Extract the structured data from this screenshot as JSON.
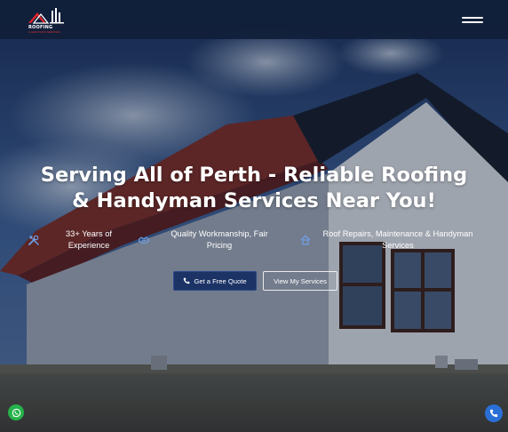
{
  "header": {
    "logo_brand": "ROOFING",
    "logo_tag": "& HANDYMAN SERVICES",
    "menu_icon": "hamburger-icon"
  },
  "hero": {
    "headline_line1": "Serving All of Perth - Reliable Roofing",
    "headline_line2": "& Handyman Services Near You!",
    "features": [
      {
        "icon": "tools-icon",
        "line1": "33+ Years of",
        "line2": "Experience"
      },
      {
        "icon": "handshake-icon",
        "line1": "Quality Workmanship, Fair",
        "line2": "Pricing"
      },
      {
        "icon": "house-icon",
        "line1": "Roof Repairs, Maintenance & Handyman",
        "line2": "Services"
      }
    ],
    "buttons": {
      "quote_label": "Get a Free Quote",
      "quote_icon": "phone-icon",
      "services_label": "View My Services"
    }
  },
  "floating": {
    "whatsapp_icon": "whatsapp-icon",
    "call_icon": "phone-icon"
  },
  "colors": {
    "header_bg": "#101e38",
    "primary_button": "#1c3366",
    "whatsapp": "#25b34a",
    "call": "#2a6fd6"
  }
}
